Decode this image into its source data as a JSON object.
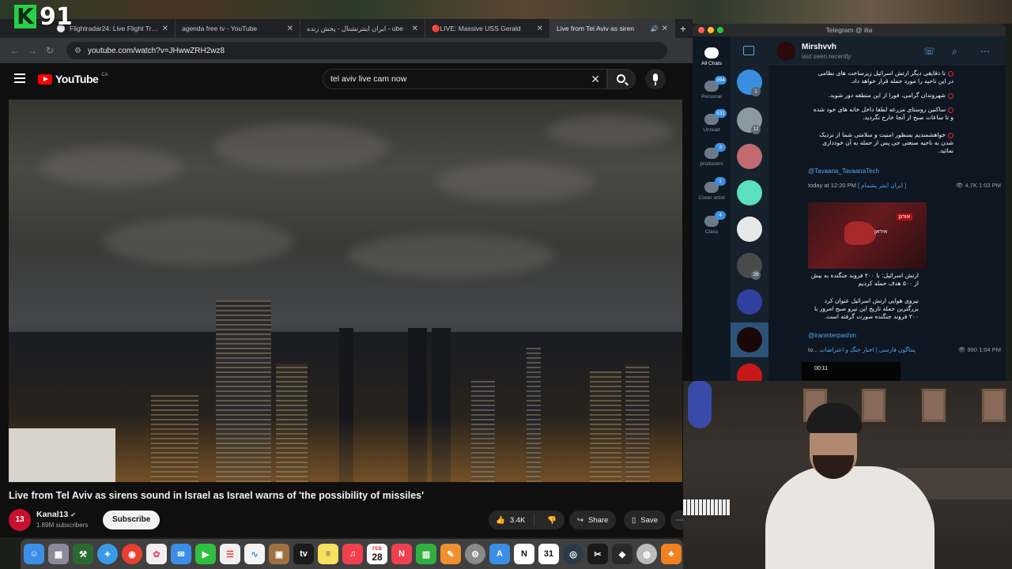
{
  "overlay": {
    "logo_letter": "K",
    "logo_number": "91"
  },
  "browser": {
    "tabs": [
      {
        "title": "Flightradar24: Live Flight Tra...",
        "favicon": "flightradar-icon",
        "active": false
      },
      {
        "title": "agenda free tv - YouTube",
        "favicon": "youtube-icon",
        "active": false
      },
      {
        "title": "ایران اینترنشنال - پخش زنده - ube",
        "favicon": "youtube-icon",
        "active": false
      },
      {
        "title": "🔴LIVE: Massive USS Gerald",
        "favicon": "youtube-icon",
        "active": false
      },
      {
        "title": "Live from Tel Aviv as siren",
        "favicon": "youtube-icon",
        "active": true
      }
    ],
    "url": "youtube.com/watch?v=JHwwZRH2wz8"
  },
  "youtube": {
    "logo_text": "YouTube",
    "region": "CA",
    "search_value": "tel aviv live cam now",
    "video_title": "Live from Tel Aviv as sirens sound in Israel as Israel warns of 'the possibility of missiles'",
    "channel": {
      "name": "Kanal13",
      "avatar_text": "13",
      "subscribers": "1.89M subscribers"
    },
    "subscribe_label": "Subscribe",
    "likes": "3.4K",
    "share_label": "Share",
    "save_label": "Save",
    "more_label": "⋯"
  },
  "telegram": {
    "window_title": "Telegram @ ilia",
    "folders": [
      {
        "label": "All Chats",
        "badge": ""
      },
      {
        "label": "Personal",
        "badge": "394"
      },
      {
        "label": "Unread",
        "badge": "531"
      },
      {
        "label": "producers",
        "badge": "3"
      },
      {
        "label": "Cover artist",
        "badge": "1"
      },
      {
        "label": "Class",
        "badge": "4"
      }
    ],
    "chat_badges": [
      "1",
      "12",
      "",
      "",
      "",
      "28",
      "",
      "",
      ""
    ],
    "contact": {
      "name": "Mirshvvh",
      "status": "last seen recently"
    },
    "messages": {
      "fa1": "تا دقایقی دیگر ارتش اسرائیل زیرساخت های نظامی در این ناحیه را مورد حمله قرار خواهد داد.",
      "fa2": "شهروندان گرامی، فورا از این منطقه دور شوید.",
      "fa3": "ساکنین روستای مزرعه لطفا داخل خانه های خود شده و تا ساعات صبح از آنجا خارج نگردید.",
      "fa4": "خواهشمندیم بمنظور امنیت و سلامتی شما از نزدیک شدن به ناحیه صنعتی جی پس از حمله به آن خودداری نمائید.",
      "link1": "@Tavaana_TavaanaTech",
      "meta1": "today at 12:20 PM",
      "meta1_src": "[ ایران اینتر پشمام ]",
      "views1": "4.7K 1:03 PM",
      "thumb_tag": "אורגן",
      "thumb_tag2": "איראן",
      "fa5": "ارتش اسرائیل: با ۲۰۰ فروند جنگنده به بیش از ۵۰۰ هدف حمله کردیم",
      "fa6": "نیروی هوایی ارتش اسرائیل عنوان کرد بزرگترین حمله تاریخ این نیرو صبح امروز با ۲۰۰ فروند جنگنده صورت گرفته است.",
      "link2": "@iraninterpashm",
      "meta2_prefix": "to...",
      "meta2_src": "پنتاگون فارسی | اخبار جنگ و اعتراضات",
      "views2": "990 1:04 PM",
      "duration": "00:11"
    }
  },
  "dock": {
    "calendar_month": "FEB",
    "calendar_day": "28",
    "icons": [
      "finder-icon",
      "launchpad-icon",
      "xcode-icon",
      "safari-icon",
      "chrome-icon",
      "photos-icon",
      "mail-icon",
      "facetime-icon",
      "reminders-icon",
      "freeform-icon",
      "finance-icon",
      "apple-tv-icon",
      "notes-icon",
      "music-icon",
      "calendar-icon",
      "news-icon",
      "numbers-icon",
      "pages-icon",
      "settings-icon",
      "appstore-icon",
      "notion-icon",
      "calendar-31-icon",
      "instruments-icon",
      "capcut-icon",
      "unity-icon",
      "disk-utility-icon",
      "fl-studio-icon"
    ]
  }
}
